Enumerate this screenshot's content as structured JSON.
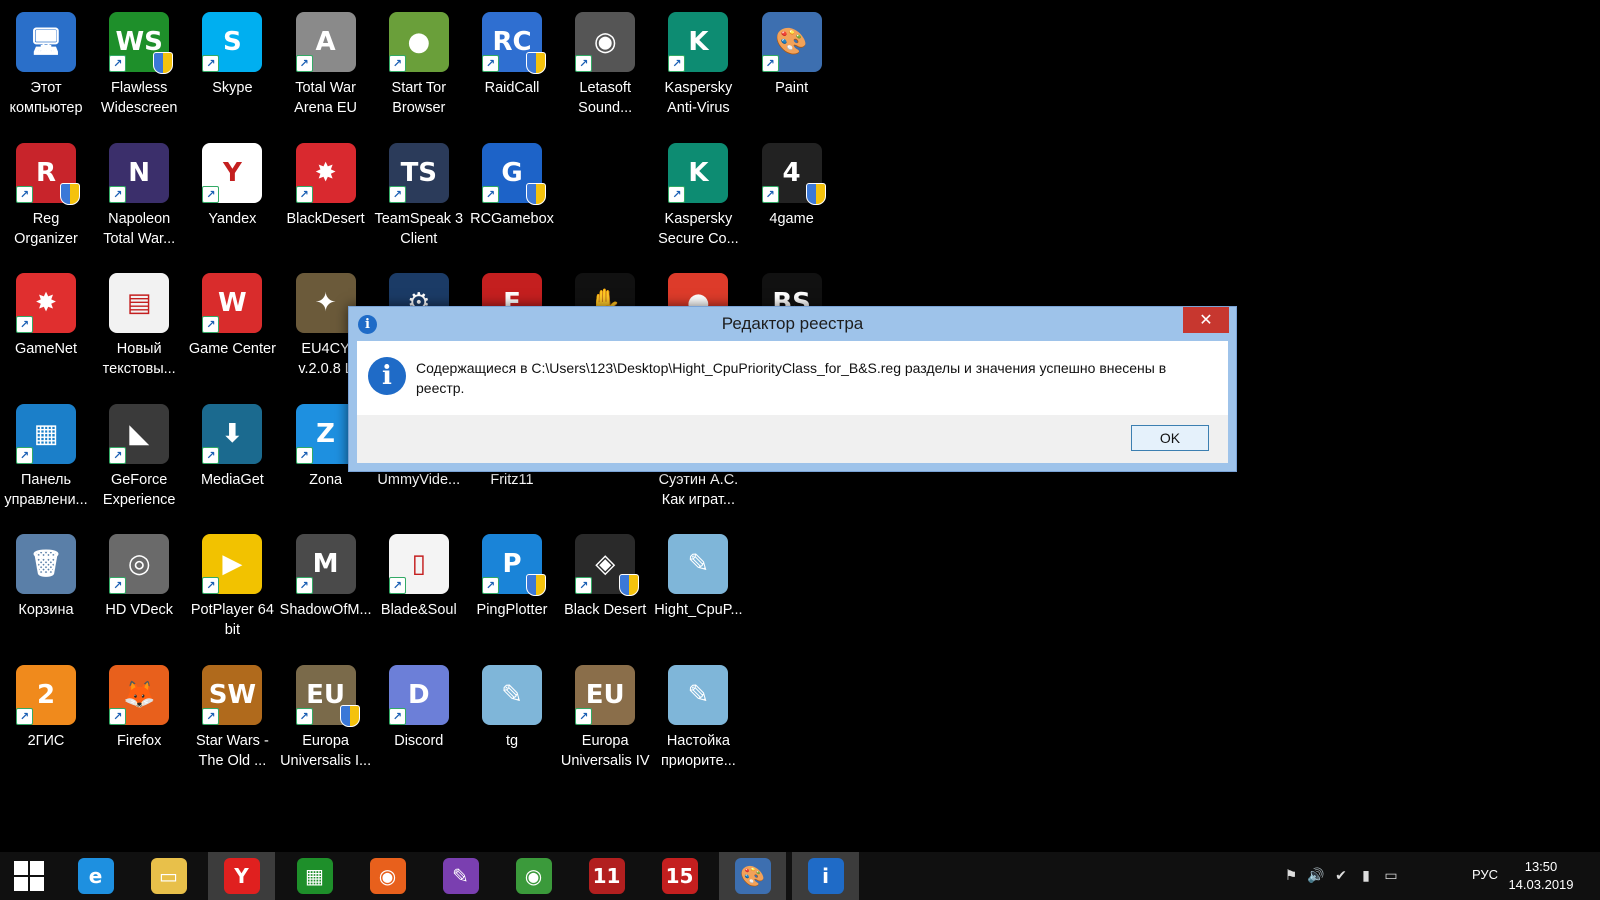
{
  "desktop": {
    "icons": [
      {
        "label": "Этот компьютер",
        "glyph": "🖥",
        "color": "#2a6fc9",
        "arrow": false,
        "shield": false
      },
      {
        "label": "Flawless Widescreen",
        "glyph": "WS",
        "color": "#1e8f2a",
        "arrow": true,
        "shield": true
      },
      {
        "label": "Skype",
        "glyph": "S",
        "color": "#00aff0",
        "arrow": true,
        "shield": false
      },
      {
        "label": "Total War Arena EU",
        "glyph": "A",
        "color": "#8a8a8a",
        "arrow": true,
        "shield": false
      },
      {
        "label": "Start Tor Browser",
        "glyph": "●",
        "color": "#6a9f3a",
        "arrow": true,
        "shield": false
      },
      {
        "label": "RaidCall",
        "glyph": "RC",
        "color": "#2f6fd1",
        "arrow": true,
        "shield": true
      },
      {
        "label": "Letasoft Sound...",
        "glyph": "◉",
        "color": "#555555",
        "arrow": true,
        "shield": false
      },
      {
        "label": "Kaspersky Anti-Virus",
        "glyph": "K",
        "color": "#0d8c72",
        "arrow": true,
        "shield": false
      },
      {
        "label": "Paint",
        "glyph": "🎨",
        "color": "#3d6fb0",
        "arrow": true,
        "shield": false
      },
      {
        "label": "Reg Organizer",
        "glyph": "R",
        "color": "#c8242b",
        "arrow": true,
        "shield": true
      },
      {
        "label": "Napoleon Total War...",
        "glyph": "N",
        "color": "#3b2f6b",
        "arrow": true,
        "shield": false
      },
      {
        "label": "Yandex",
        "glyph": "Y",
        "color": "#ffffff",
        "arrow": true,
        "shield": false
      },
      {
        "label": "BlackDesert",
        "glyph": "✸",
        "color": "#d9292f",
        "arrow": true,
        "shield": false
      },
      {
        "label": "TeamSpeak 3 Client",
        "glyph": "TS",
        "color": "#2b3b5a",
        "arrow": true,
        "shield": false
      },
      {
        "label": "RCGamebox",
        "glyph": "G",
        "color": "#1d63c8",
        "arrow": true,
        "shield": true
      },
      {
        "label": "Kaspersky Secure Co...",
        "glyph": "K",
        "color": "#0d8c72",
        "arrow": true,
        "shield": false
      },
      {
        "label": "4game",
        "glyph": "4",
        "color": "#222222",
        "arrow": true,
        "shield": true
      },
      {
        "label": "GameNet",
        "glyph": "✸",
        "color": "#e02f2f",
        "arrow": true,
        "shield": false
      },
      {
        "label": "Новый текстовы...",
        "glyph": "▤",
        "color": "#f2f2f2",
        "arrow": false,
        "shield": false
      },
      {
        "label": "Game Center",
        "glyph": "W",
        "color": "#d92c2c",
        "arrow": true,
        "shield": false
      },
      {
        "label": "EU4CY v.2.0.8 L",
        "glyph": "✦",
        "color": "#6b5a3a",
        "arrow": false,
        "shield": false
      },
      {
        "label": "Панель управлени...",
        "glyph": "▦",
        "color": "#1b7fc9",
        "arrow": true,
        "shield": false
      },
      {
        "label": "GeForce Experience",
        "glyph": "◣",
        "color": "#3a3a3a",
        "arrow": true,
        "shield": false
      },
      {
        "label": "MediaGet",
        "glyph": "⬇",
        "color": "#1b6a8f",
        "arrow": true,
        "shield": false
      },
      {
        "label": "Zona",
        "glyph": "Z",
        "color": "#1e90e0",
        "arrow": true,
        "shield": false
      },
      {
        "label": "UmmyVide...",
        "glyph": "",
        "color": "#000000",
        "arrow": false,
        "shield": false
      },
      {
        "label": "Fritz11",
        "glyph": "",
        "color": "#000000",
        "arrow": false,
        "shield": false
      },
      {
        "label": "Суэтин А.С. Как играт...",
        "glyph": "",
        "color": "#000000",
        "arrow": false,
        "shield": false
      },
      {
        "label": "Корзина",
        "glyph": "🗑",
        "color": "#5a7fa8",
        "arrow": false,
        "shield": false
      },
      {
        "label": "HD VDeck",
        "glyph": "◎",
        "color": "#6a6a6a",
        "arrow": true,
        "shield": false
      },
      {
        "label": "PotPlayer 64 bit",
        "glyph": "▶",
        "color": "#f2c200",
        "arrow": true,
        "shield": false
      },
      {
        "label": "ShadowOfM...",
        "glyph": "M",
        "color": "#4a4a4a",
        "arrow": true,
        "shield": false
      },
      {
        "label": "Blade&Soul",
        "glyph": "▯",
        "color": "#f4f4f4",
        "arrow": true,
        "shield": false
      },
      {
        "label": "PingPlotter",
        "glyph": "P",
        "color": "#1a84d8",
        "arrow": true,
        "shield": true
      },
      {
        "label": "Black Desert",
        "glyph": "◈",
        "color": "#2a2a2a",
        "arrow": true,
        "shield": true
      },
      {
        "label": "Hight_CpuP...",
        "glyph": "✎",
        "color": "#7fb6d9",
        "arrow": false,
        "shield": false
      },
      {
        "label": "2ГИС",
        "glyph": "2",
        "color": "#f08a1c",
        "arrow": true,
        "shield": false
      },
      {
        "label": "Firefox",
        "glyph": "🦊",
        "color": "#e8601c",
        "arrow": true,
        "shield": false
      },
      {
        "label": "Star Wars - The Old ...",
        "glyph": "SW",
        "color": "#b06a1c",
        "arrow": true,
        "shield": false
      },
      {
        "label": "Europa Universalis I...",
        "glyph": "EU",
        "color": "#7a6a4a",
        "arrow": true,
        "shield": true
      },
      {
        "label": "Discord",
        "glyph": "D",
        "color": "#6c7fd8",
        "arrow": true,
        "shield": false
      },
      {
        "label": "tg",
        "glyph": "✎",
        "color": "#7fb6d9",
        "arrow": false,
        "shield": false
      },
      {
        "label": "Europa Universalis IV",
        "glyph": "EU",
        "color": "#8a6e4a",
        "arrow": true,
        "shield": false
      },
      {
        "label": "Настойка приорите...",
        "glyph": "✎",
        "color": "#7fb6d9",
        "arrow": false,
        "shield": false
      }
    ],
    "hidden_row3_icons": [
      {
        "glyph": "⚙",
        "color": "#1b3b66"
      },
      {
        "glyph": "F",
        "color": "#c41f1f"
      },
      {
        "glyph": "✋",
        "color": "#111111"
      },
      {
        "glyph": "●",
        "color": "#dd3b2a"
      },
      {
        "glyph": "BS",
        "color": "#111111"
      }
    ]
  },
  "dialog": {
    "title": "Редактор реестра",
    "close_glyph": "✕",
    "info_glyph": "i",
    "message": "Содержащиеся в C:\\Users\\123\\Desktop\\Hight_CpuPriorityClass_for_B&S.reg разделы и значения успешно внесены в реестр.",
    "ok_label": "OK"
  },
  "taskbar": {
    "pinned": [
      {
        "name": "internet-explorer-icon",
        "glyph": "e",
        "color": "#1e90e0",
        "active": false
      },
      {
        "name": "file-explorer-icon",
        "glyph": "▭",
        "color": "#e8c04a",
        "active": false
      },
      {
        "name": "yandex-browser-icon",
        "glyph": "Y",
        "color": "#e0201f",
        "active": true
      },
      {
        "name": "store-icon",
        "glyph": "▦",
        "color": "#1e8f2a",
        "active": false
      },
      {
        "name": "firefox-icon",
        "glyph": "◉",
        "color": "#e8601c",
        "active": false
      },
      {
        "name": "onenote-icon",
        "glyph": "✎",
        "color": "#7a3fb0",
        "active": false
      },
      {
        "name": "chrome-icon",
        "glyph": "◉",
        "color": "#3b9a3b",
        "active": false
      },
      {
        "name": "fritz11-icon",
        "glyph": "11",
        "color": "#b21f1f",
        "active": false
      },
      {
        "name": "fritz15-icon",
        "glyph": "15",
        "color": "#c41f1f",
        "active": false
      },
      {
        "name": "paint-icon",
        "glyph": "🎨",
        "color": "#3d6fb0",
        "active": true
      },
      {
        "name": "regedit-info-icon",
        "glyph": "i",
        "color": "#1f6bc7",
        "active": true
      }
    ],
    "tray": {
      "language": "РУС",
      "time": "13:50",
      "date": "14.03.2019"
    }
  }
}
